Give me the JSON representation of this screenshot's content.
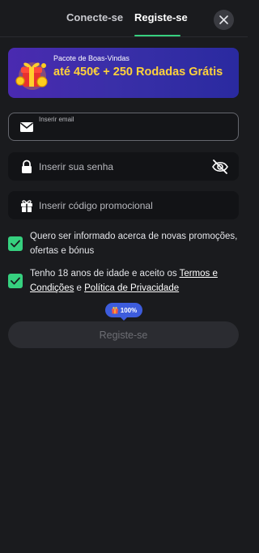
{
  "header": {
    "tabs": [
      {
        "label": "Conecte-se",
        "active": false
      },
      {
        "label": "Registe-se",
        "active": true
      }
    ],
    "close_icon": "close-icon"
  },
  "banner": {
    "kicker": "Pacote de Boas-Vindas",
    "title": "até 450€ + 250 Rodadas Grátis",
    "icon": "gift-coins-icon"
  },
  "form": {
    "email": {
      "label": "Inserir email",
      "value": "",
      "icon": "envelope-icon"
    },
    "password": {
      "placeholder": "Inserir sua senha",
      "icon": "lock-icon",
      "toggle_icon": "eye-off-icon"
    },
    "promo": {
      "placeholder": "Inserir código promocional",
      "icon": "gift-icon"
    },
    "checkboxes": [
      {
        "checked": true,
        "text": "Quero ser informado acerca de novas promoções, ofertas e bónus"
      },
      {
        "checked": true,
        "text_before": "Tenho 18 anos de idade e aceito os ",
        "link1": "Termos e Condições",
        "text_mid": " e ",
        "link2": "Política de Privacidade"
      }
    ],
    "progress": {
      "label": "100%",
      "value": 1.0
    },
    "submit_label": "Registe-se"
  },
  "colors": {
    "accent": "#36d07f",
    "background": "#1a1b1e",
    "banner_title": "#ffd23a",
    "progress": "#3d5cdc"
  }
}
